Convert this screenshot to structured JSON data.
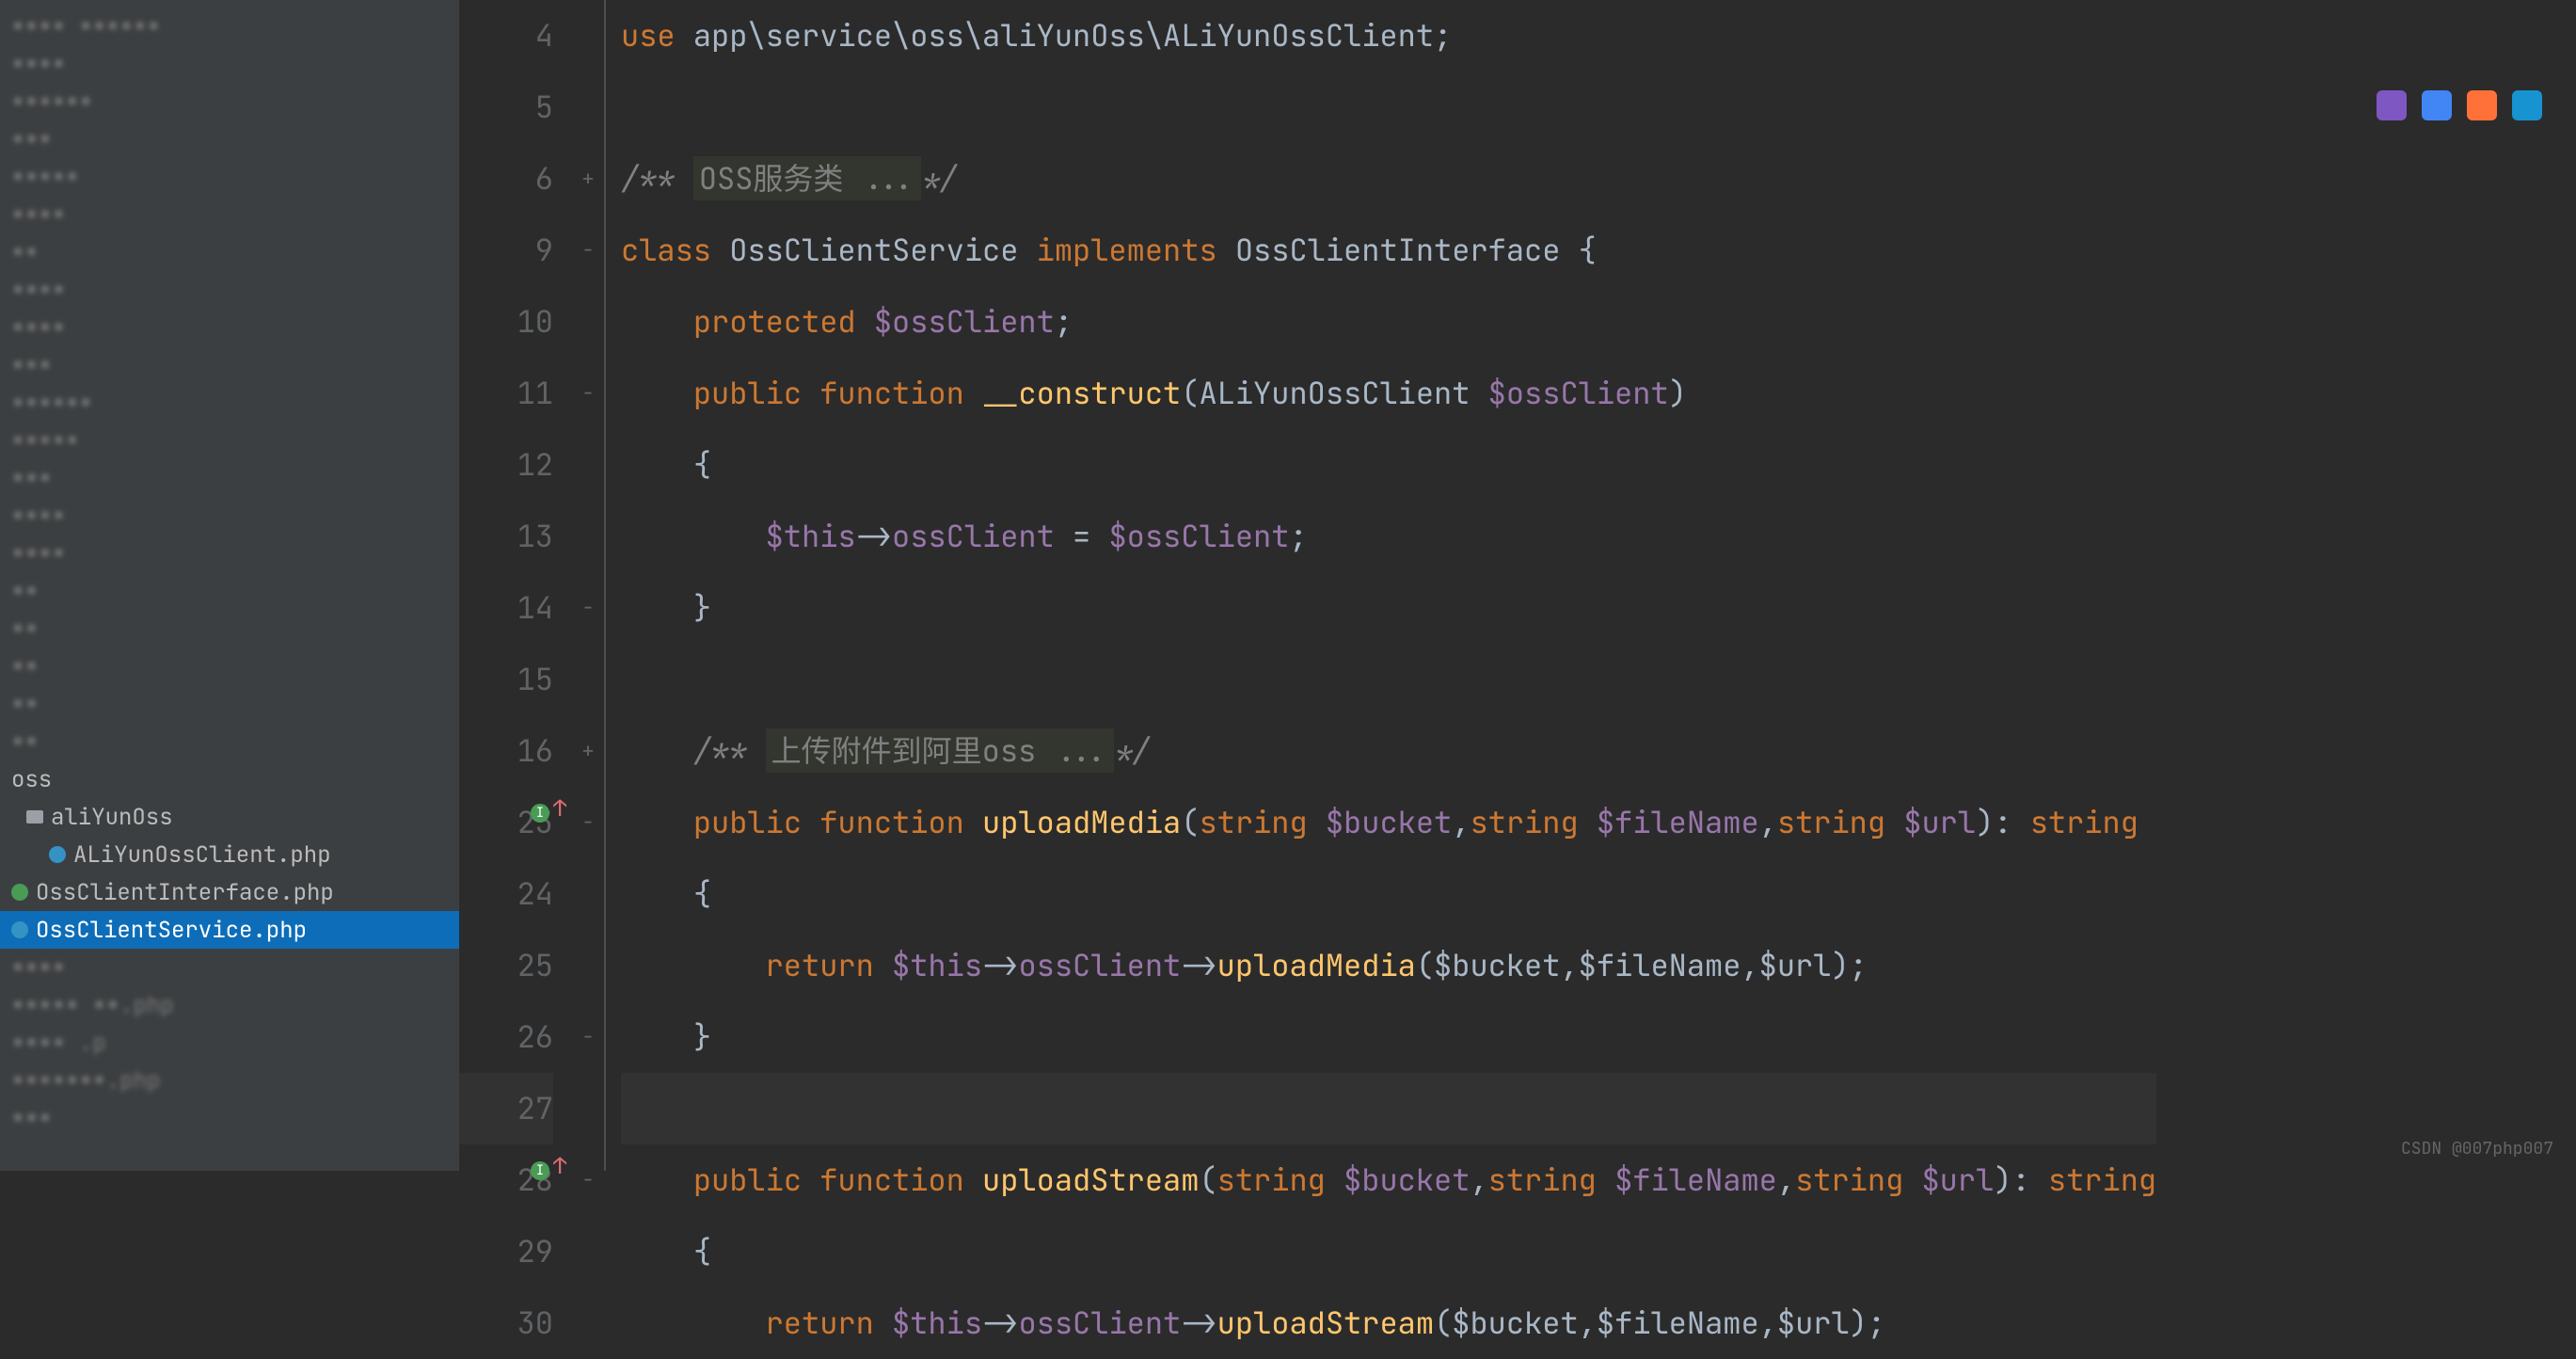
{
  "sidebar": {
    "folder_label": "aliYunOss",
    "files": [
      {
        "icon": "blue",
        "name": "ALiYunOssClient.php"
      },
      {
        "icon": "green",
        "name": "OssClientInterface.php"
      },
      {
        "icon": "blue",
        "name": "OssClientService.php",
        "selected": true
      }
    ],
    "obscured_label": "oss"
  },
  "line_numbers": [
    "4",
    "5",
    "6",
    "9",
    "10",
    "11",
    "12",
    "13",
    "14",
    "15",
    "16",
    "23",
    "24",
    "25",
    "26",
    "27",
    "28",
    "29",
    "30"
  ],
  "folds": [
    "",
    "",
    "+",
    "-",
    "",
    "-",
    "",
    "",
    "-",
    "",
    "+",
    "-",
    "",
    "",
    "-",
    "",
    "-",
    "",
    ""
  ],
  "code": {
    "t1_use": "use",
    "t1_path": "app\\service\\oss\\aliYunOss\\ALiYunOssClient",
    "t3_cmt_open": "/** ",
    "t3_cmt_text": "OSS服务类 ...",
    "t3_cmt_close": "*/",
    "t4_class": "class",
    "t4_name": "OssClientService",
    "t4_impl": "implements",
    "t4_iface": "OssClientInterface",
    "t4_brace": " {",
    "t5_protected": "protected",
    "t5_var": "$ossClient",
    "t6_public": "public",
    "t6_function": "function",
    "t6_name": "__construct",
    "t6_argtype": "ALiYunOssClient",
    "t6_argvar": "$ossClient",
    "t8_this": "$this",
    "t8_arrow": "->",
    "t8_prop": "ossClient",
    "t8_eq": " = ",
    "t8_rhs": "$ossClient",
    "t11_cmt_open": "/** ",
    "t11_cmt_text": "上传附件到阿里oss ...",
    "t11_cmt_close": "*/",
    "t12_public": "public",
    "t12_function": "function",
    "t12_name": "uploadMedia",
    "t12_kw_string": "string",
    "t12_p1": "$bucket",
    "t12_p2": "$fileName",
    "t12_p3": "$url",
    "t12_ret": ": ",
    "t12_rettype": "string",
    "t14_return": "return",
    "t14_call": "uploadMedia",
    "t14_args": "($bucket,$fileName,$url);",
    "t17_public": "public",
    "t17_function": "function",
    "t17_name": "uploadStream",
    "t19_return": "return",
    "t19_call": "uploadStream",
    "brace_open": "{",
    "brace_close": "}",
    "semicolon": ";",
    "paren_open": "(",
    "paren_close": ")"
  },
  "watermark": "CSDN @007php007"
}
